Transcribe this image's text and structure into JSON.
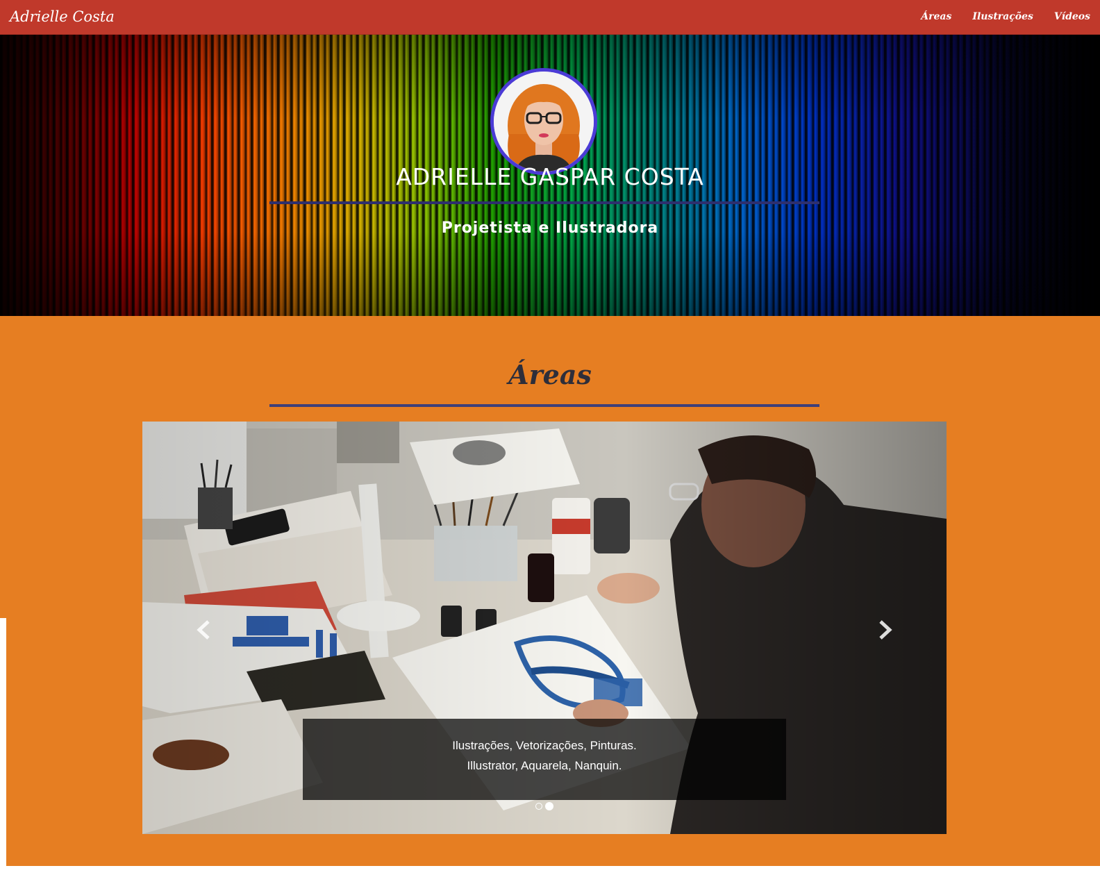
{
  "navbar": {
    "brand": "Adrielle Costa",
    "links": [
      {
        "label": "Áreas"
      },
      {
        "label": "Ilustrações"
      },
      {
        "label": "Vídeos"
      }
    ]
  },
  "hero": {
    "name": "ADRIELLE GASPAR COSTA",
    "subtitle": "Projetista e Ilustradora"
  },
  "areas": {
    "title": "Áreas",
    "carousel": {
      "caption_line1": "Ilustrações, Vetorizações, Pinturas.",
      "caption_line2": "Illustrator, Aquarela, Nanquin.",
      "slide_count": 2,
      "active_index": 1
    }
  },
  "colors": {
    "navbar": "#c0392b",
    "section_bg": "#e67e22",
    "rule": "#3e3f7a",
    "avatar_ring": "#4b3bd6"
  },
  "icons": [
    "chevron-left-icon",
    "chevron-right-icon"
  ]
}
